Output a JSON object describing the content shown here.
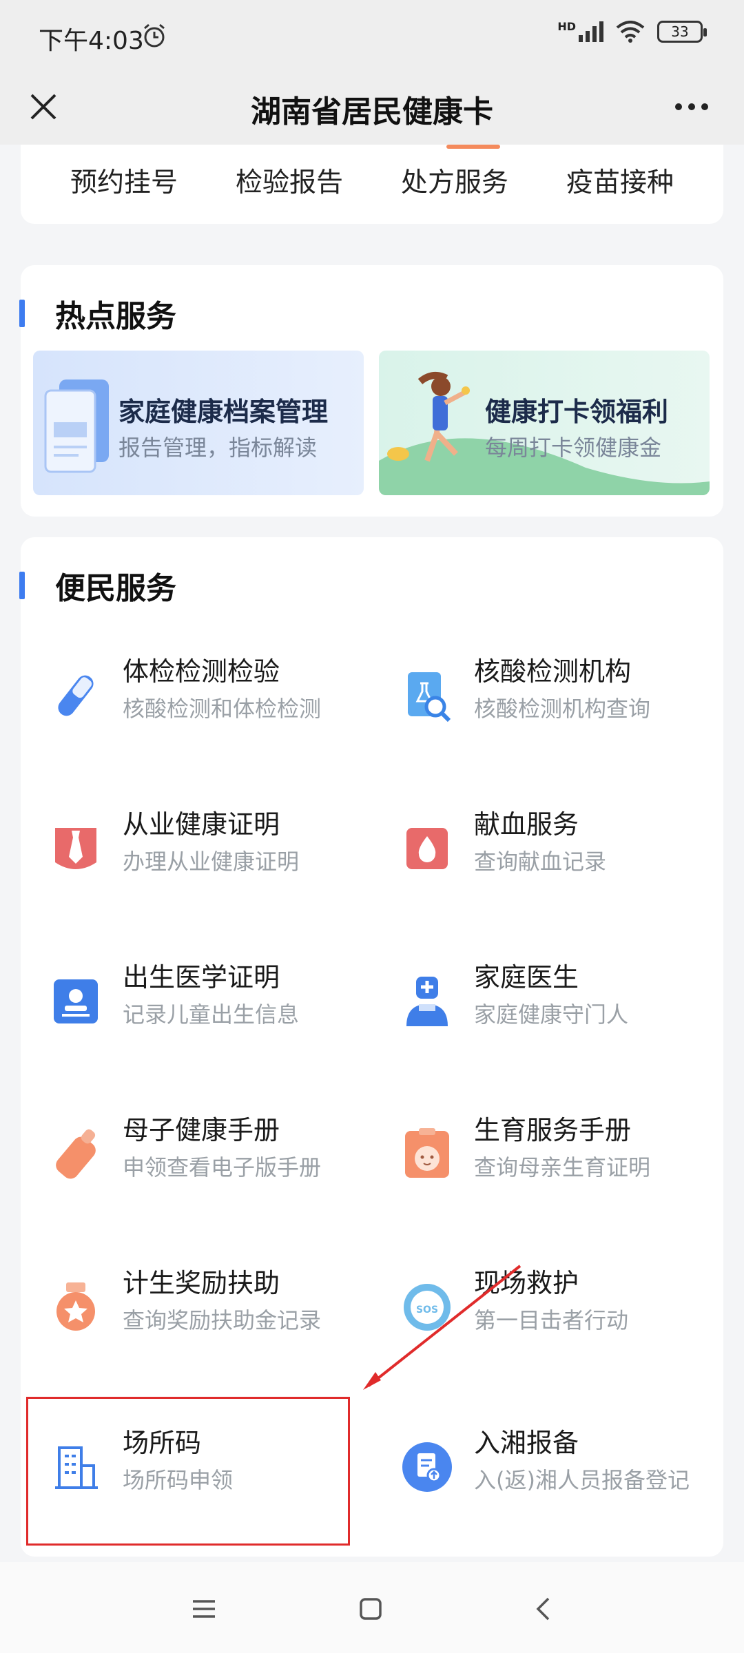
{
  "status_bar": {
    "time": "下午4:03",
    "network": "HD",
    "battery": "33"
  },
  "header": {
    "title": "湖南省居民健康卡"
  },
  "top_tabs": [
    "预约挂号",
    "检验报告",
    "处方服务",
    "疫苗接种"
  ],
  "hot_services": {
    "title": "热点服务",
    "items": [
      {
        "title": "家庭健康档案管理",
        "subtitle": "报告管理，指标解读"
      },
      {
        "title": "健康打卡领福利",
        "subtitle": "每周打卡领健康金"
      }
    ]
  },
  "convenience_services": {
    "title": "便民服务",
    "items": [
      {
        "title": "体检检测检验",
        "subtitle": "核酸检测和体检检测",
        "icon": "test-tube-icon"
      },
      {
        "title": "核酸检测机构",
        "subtitle": "核酸检测机构查询",
        "icon": "lab-search-icon"
      },
      {
        "title": "从业健康证明",
        "subtitle": "办理从业健康证明",
        "icon": "tie-certificate-icon"
      },
      {
        "title": "献血服务",
        "subtitle": "查询献血记录",
        "icon": "blood-drop-icon"
      },
      {
        "title": "出生医学证明",
        "subtitle": "记录儿童出生信息",
        "icon": "baby-id-icon"
      },
      {
        "title": "家庭医生",
        "subtitle": "家庭健康守门人",
        "icon": "doctor-icon"
      },
      {
        "title": "母子健康手册",
        "subtitle": "申领查看电子版手册",
        "icon": "baby-bottle-icon"
      },
      {
        "title": "生育服务手册",
        "subtitle": "查询母亲生育证明",
        "icon": "baby-face-icon"
      },
      {
        "title": "计生奖励扶助",
        "subtitle": "查询奖励扶助金记录",
        "icon": "medal-icon"
      },
      {
        "title": "现场救护",
        "subtitle": "第一目击者行动",
        "icon": "sos-icon"
      },
      {
        "title": "场所码",
        "subtitle": "场所码申领",
        "icon": "building-icon"
      },
      {
        "title": "入湘报备",
        "subtitle": "入(返)湘人员报备登记",
        "icon": "report-upload-icon"
      }
    ]
  },
  "colors": {
    "accent": "#3d7cf0",
    "tab_indicator": "#f48a5c",
    "annotation": "#e02b2b"
  }
}
